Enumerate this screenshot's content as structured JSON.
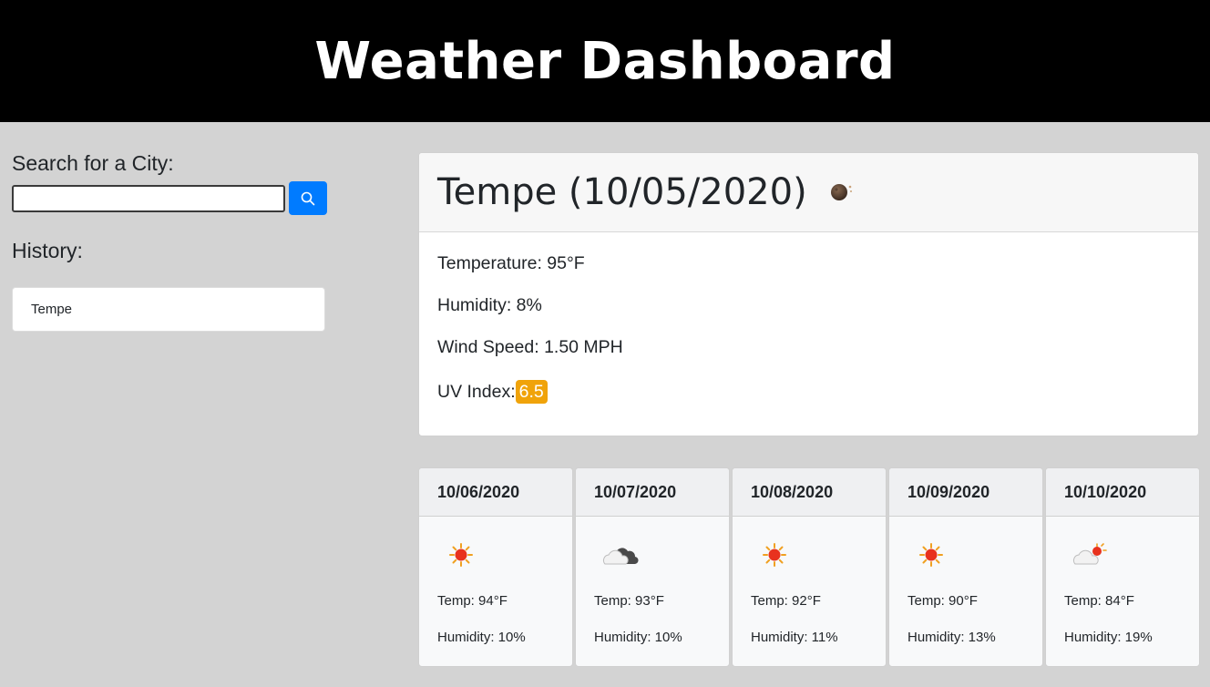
{
  "header": {
    "title": "Weather Dashboard"
  },
  "sidebar": {
    "search_label": "Search for a City:",
    "search_value": "",
    "search_button_icon": "search-icon",
    "history_label": "History:",
    "history": [
      "Tempe"
    ]
  },
  "current": {
    "title": "Tempe (10/05/2020)",
    "icon": "moon-icon",
    "temperature": "Temperature: 95°F",
    "humidity": "Humidity: 8%",
    "wind": "Wind Speed: 1.50 MPH",
    "uv_label": "UV Index:",
    "uv_value": "6.5",
    "uv_color": "#f0a30a"
  },
  "forecast": [
    {
      "date": "10/06/2020",
      "icon": "sun-icon",
      "temp": "Temp: 94°F",
      "humidity": "Humidity: 10%"
    },
    {
      "date": "10/07/2020",
      "icon": "cloud-icon",
      "temp": "Temp: 93°F",
      "humidity": "Humidity: 10%"
    },
    {
      "date": "10/08/2020",
      "icon": "sun-icon",
      "temp": "Temp: 92°F",
      "humidity": "Humidity: 11%"
    },
    {
      "date": "10/09/2020",
      "icon": "sun-icon",
      "temp": "Temp: 90°F",
      "humidity": "Humidity: 13%"
    },
    {
      "date": "10/10/2020",
      "icon": "partly-cloudy-icon",
      "temp": "Temp: 84°F",
      "humidity": "Humidity: 19%"
    }
  ],
  "colors": {
    "header_bg": "#000000",
    "page_bg": "#d3d3d3",
    "accent": "#007bff"
  }
}
